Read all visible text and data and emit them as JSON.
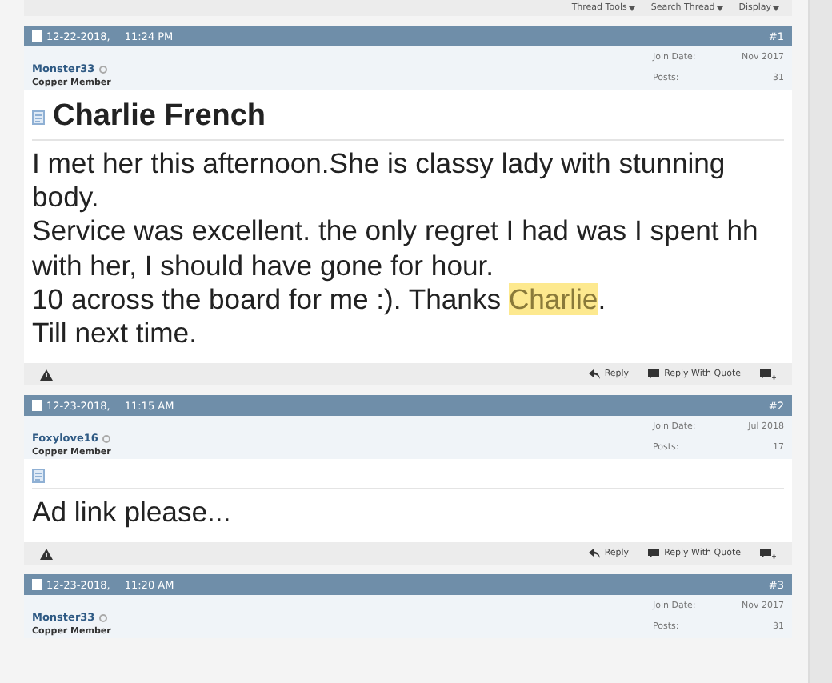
{
  "toolbar": [
    "Thread Tools",
    "Search Thread",
    "Display"
  ],
  "posts": [
    {
      "date": "12-22-2018,",
      "time": "11:24 PM",
      "number": "#1",
      "username": "Monster33",
      "online": false,
      "rank": "Copper Member",
      "join_label": "Join Date:",
      "join_date": "Nov 2017",
      "posts_label": "Posts:",
      "posts": "31",
      "title": "Charlie French",
      "paragraphs": [
        [
          {
            "text": "I met her this afternoon.She is classy lady with stunning body."
          }
        ],
        [
          {
            "text": "Service was excellent. the only regret I had was I spent hh with her, I should have gone for hour."
          }
        ],
        [
          {
            "text": "10 across the board for me :). Thanks "
          },
          {
            "text": "Charlie",
            "highlighted": true
          },
          {
            "text": "."
          }
        ],
        [
          {
            "text": "Till next time."
          }
        ]
      ],
      "actions": [
        "Reply",
        "Reply With Quote"
      ]
    },
    {
      "date": "12-23-2018,",
      "time": "11:15 AM",
      "number": "#2",
      "username": "Foxylove16",
      "online": false,
      "rank": "Copper Member",
      "join_label": "Join Date:",
      "join_date": "Jul 2018",
      "posts_label": "Posts:",
      "posts": "17",
      "paragraphs": [
        [
          {
            "text": "Ad link please..."
          }
        ]
      ],
      "actions": [
        "Reply",
        "Reply With Quote"
      ]
    },
    {
      "date": "12-23-2018,",
      "time": "11:20 AM",
      "number": "#3",
      "username": "Monster33",
      "online": false,
      "rank": "Copper Member",
      "join_label": "Join Date:",
      "join_date": "Nov 2017",
      "posts_label": "Posts:",
      "posts": "31"
    }
  ]
}
